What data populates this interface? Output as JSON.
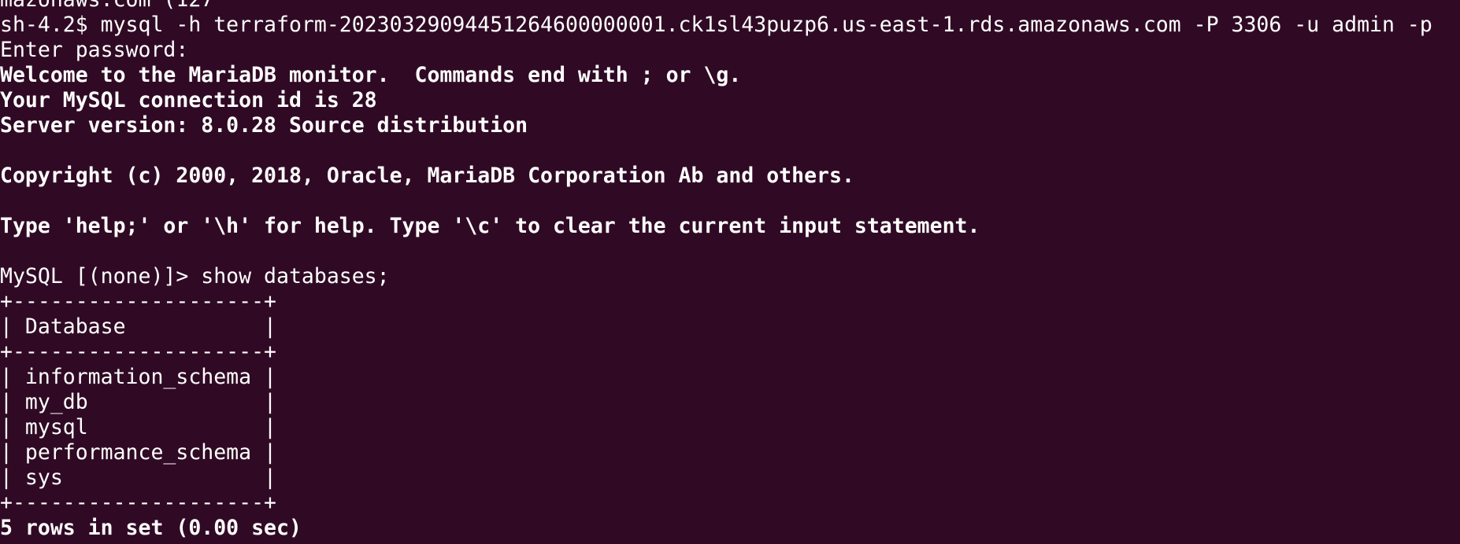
{
  "terminal": {
    "colors": {
      "background": "#300a24",
      "foreground": "#ffffff"
    },
    "lines": [
      {
        "text": "mazonaws.com (127",
        "bold": false
      },
      {
        "text": "sh-4.2$ mysql -h terraform-20230329094451264600000001.ck1sl43puzp6.us-east-1.rds.amazonaws.com -P 3306 -u admin -p",
        "bold": false
      },
      {
        "text": "Enter password:",
        "bold": false
      },
      {
        "text": "Welcome to the MariaDB monitor.  Commands end with ; or \\g.",
        "bold": true
      },
      {
        "text": "Your MySQL connection id is 28",
        "bold": true
      },
      {
        "text": "Server version: 8.0.28 Source distribution",
        "bold": true
      },
      {
        "text": "",
        "bold": false
      },
      {
        "text": "Copyright (c) 2000, 2018, Oracle, MariaDB Corporation Ab and others.",
        "bold": true
      },
      {
        "text": "",
        "bold": false
      },
      {
        "text": "Type 'help;' or '\\h' for help. Type '\\c' to clear the current input statement.",
        "bold": true
      },
      {
        "text": "",
        "bold": false
      },
      {
        "text": "MySQL [(none)]> show databases;",
        "bold": false
      },
      {
        "text": "+--------------------+",
        "bold": false
      },
      {
        "text": "| Database           |",
        "bold": false
      },
      {
        "text": "+--------------------+",
        "bold": false
      },
      {
        "text": "| information_schema |",
        "bold": false
      },
      {
        "text": "| my_db              |",
        "bold": false
      },
      {
        "text": "| mysql              |",
        "bold": false
      },
      {
        "text": "| performance_schema |",
        "bold": false
      },
      {
        "text": "| sys                |",
        "bold": false
      },
      {
        "text": "+--------------------+",
        "bold": false
      },
      {
        "text": "5 rows in set (0.00 sec)",
        "bold": true
      }
    ]
  }
}
